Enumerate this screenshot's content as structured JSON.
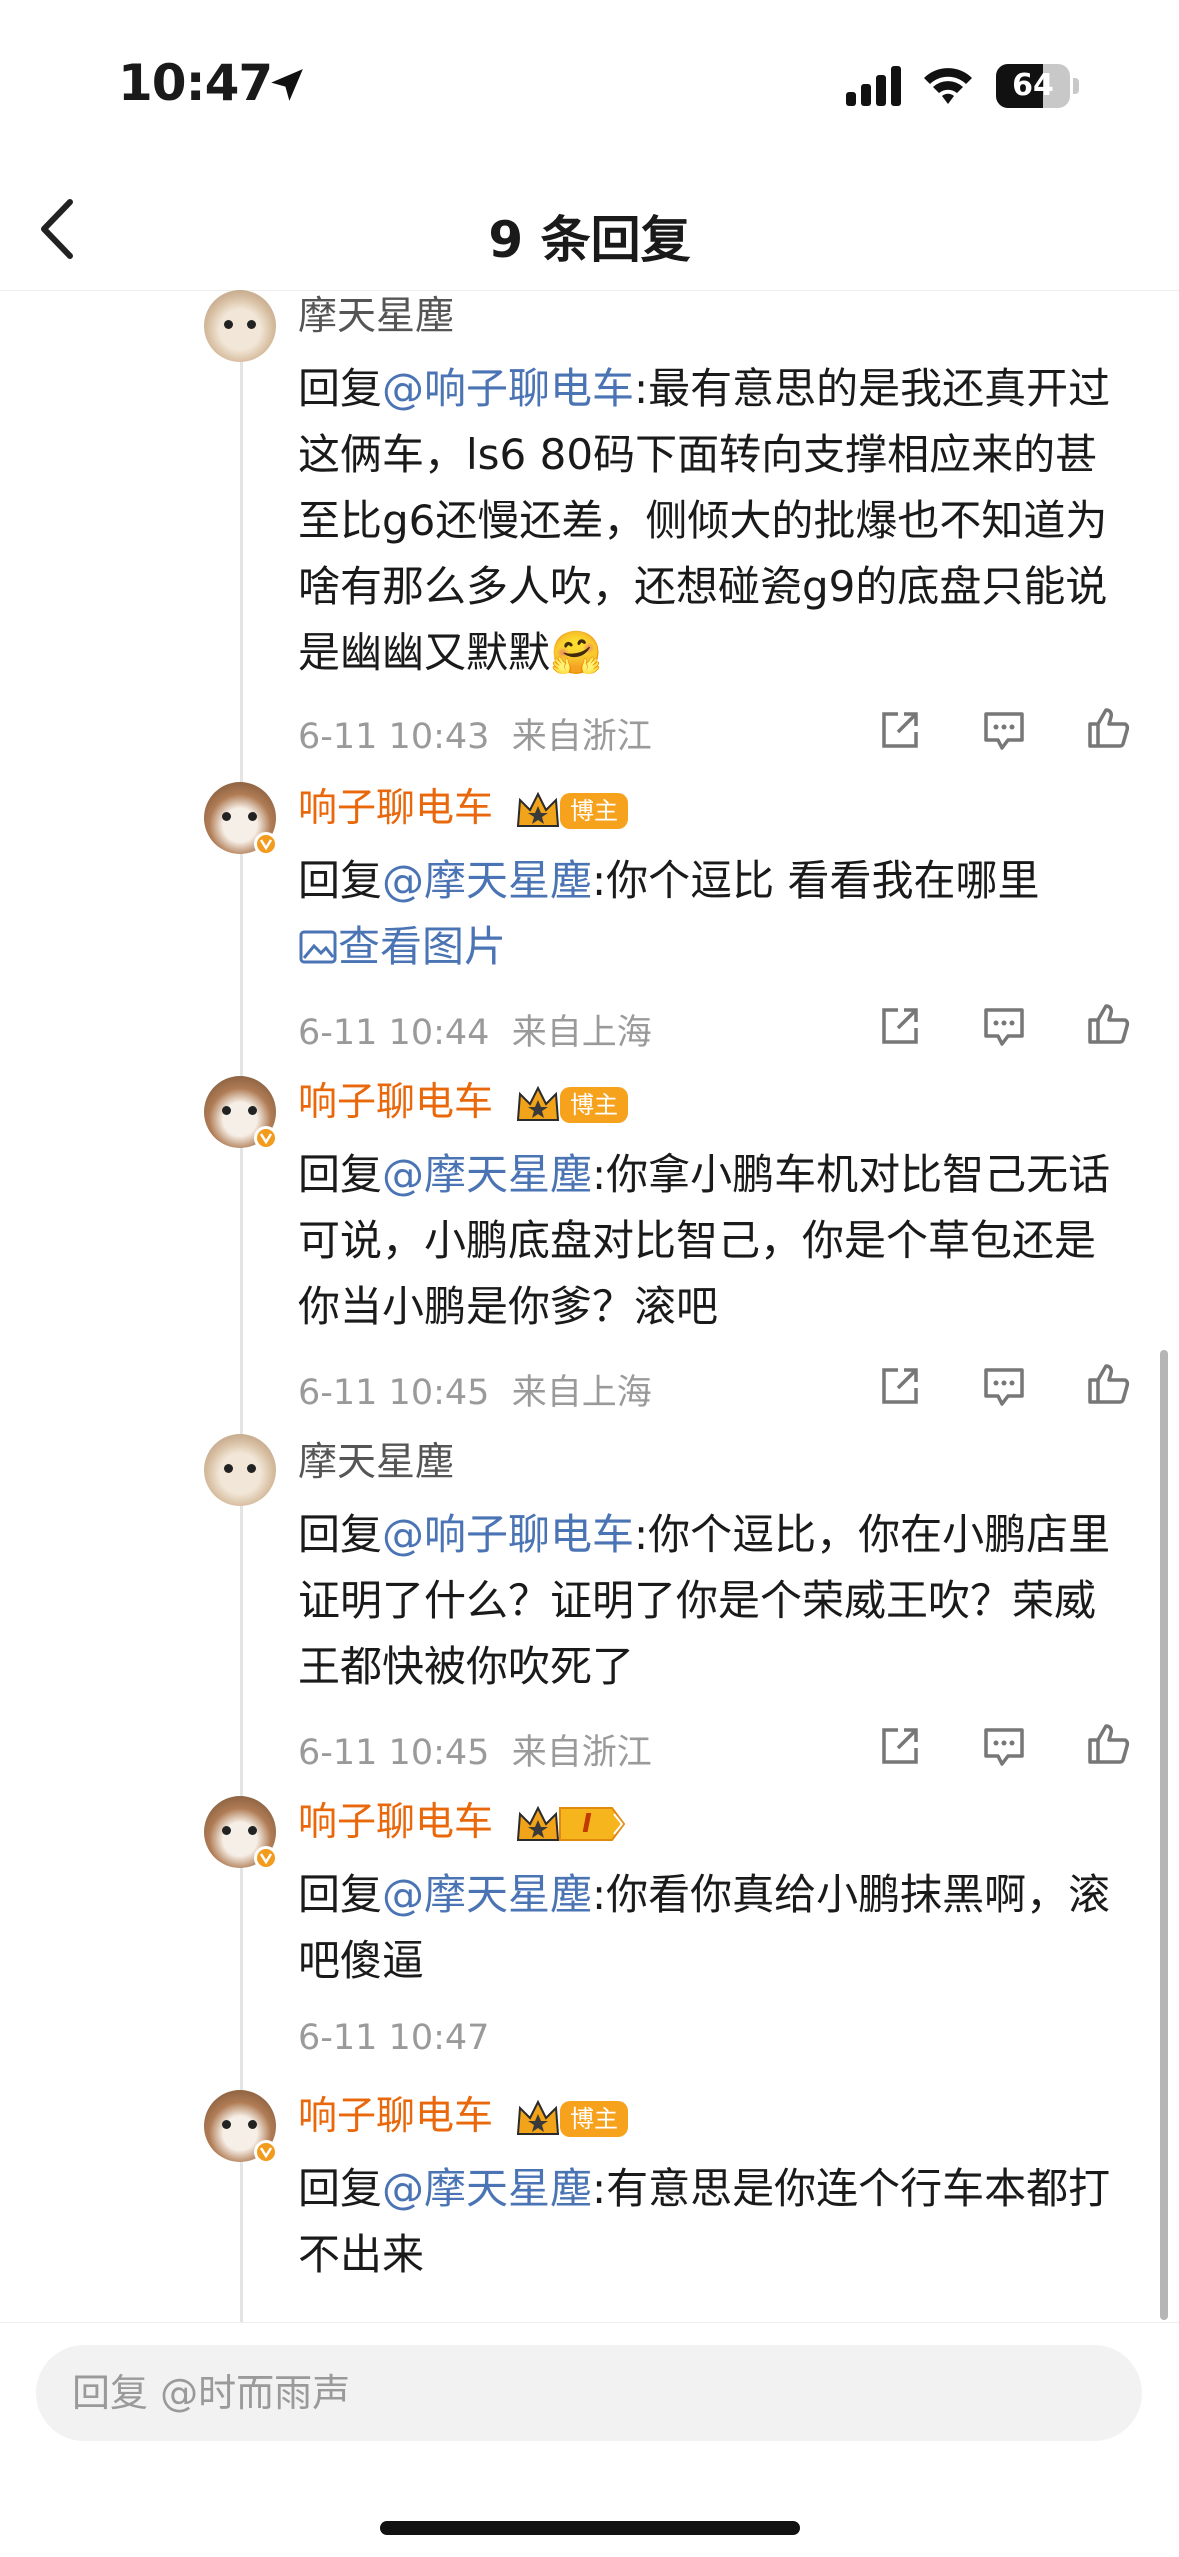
{
  "status_bar": {
    "time": "10:47",
    "battery": "64",
    "battery_percent": 64
  },
  "nav": {
    "title": "9 条回复"
  },
  "comments": [
    {
      "author": "摩天星塵",
      "prefix": "回复",
      "mention": "@响子聊电车",
      "text": ":最有意思的是我还真开过这俩车，ls6 80码下面转向支撑相应来的甚至比g6还慢还差，侧倾大的批爆也不知道为啥有那么多人吹，还想碰瓷g9的底盘只能说是幽幽又默默",
      "emoji": "🤗",
      "date": "6-11 10:43",
      "location": "来自浙江"
    },
    {
      "author": "响子聊电车",
      "badge": "博主",
      "prefix": "回复",
      "mention": "@摩天星塵",
      "text": ":你个逗比 看看我在哪里",
      "view_image": "查看图片",
      "date": "6-11 10:44",
      "location": "来自上海"
    },
    {
      "author": "响子聊电车",
      "badge": "博主",
      "prefix": "回复",
      "mention": "@摩天星塵",
      "text": ":你拿小鹏车机对比智己无话可说，小鹏底盘对比智己，你是个草包还是你当小鹏是你爹？滚吧",
      "date": "6-11 10:45",
      "location": "来自上海"
    },
    {
      "author": "摩天星塵",
      "prefix": "回复",
      "mention": "@响子聊电车",
      "text": ":你个逗比，你在小鹏店里证明了什么？证明了你是个荣威王吹？荣威王都快被你吹死了",
      "date": "6-11 10:45",
      "location": "来自浙江"
    },
    {
      "author": "响子聊电车",
      "level": "I",
      "prefix": "回复",
      "mention": "@摩天星塵",
      "text": ":你看你真给小鹏抹黑啊，滚吧傻逼",
      "date": "6-11 10:47"
    },
    {
      "author": "响子聊电车",
      "badge": "博主",
      "prefix": "回复",
      "mention": "@摩天星塵",
      "text": ":有意思是你连个行车本都打不出来"
    }
  ],
  "reply_bar": {
    "placeholder": "回复 @时而雨声"
  }
}
